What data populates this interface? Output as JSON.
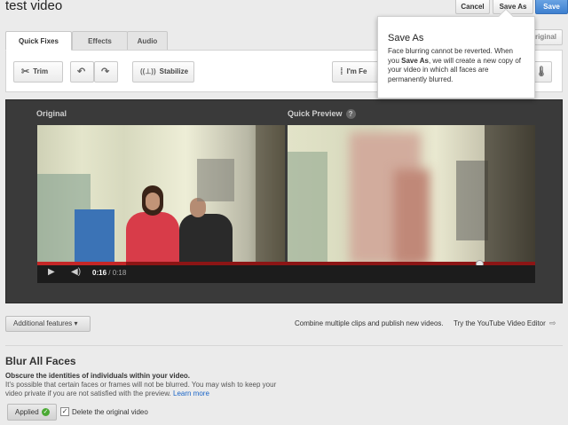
{
  "header": {
    "title": "test video",
    "cancel_label": "Cancel",
    "saveas_label": "Save As",
    "save_label": "Save"
  },
  "tabs": [
    {
      "label": "Quick Fixes"
    },
    {
      "label": "Effects"
    },
    {
      "label": "Audio"
    }
  ],
  "tools": {
    "trim_label": "Trim",
    "stabilize_label": "Stabilize",
    "feeling_lucky_label": "I'm Fe",
    "revert_label": "original"
  },
  "popup": {
    "title": "Save As",
    "text_before": "Face blurring cannot be reverted. When you ",
    "text_bold": "Save As",
    "text_after": ", we will create a new copy of your video in which all faces are permanently blurred."
  },
  "player": {
    "original_label": "Original",
    "preview_label": "Quick Preview",
    "help_glyph": "?",
    "time_current": "0:16",
    "time_total": "/ 0:18",
    "progress": 0.89
  },
  "bottom": {
    "additional_features_label": "Additional features",
    "promo_text": "Combine multiple clips and publish new videos.",
    "promo_link": "Try the YouTube Video Editor"
  },
  "blur": {
    "title": "Blur All Faces",
    "subtitle": "Obscure the identities of individuals within your video.",
    "description": "It's possible that certain faces or frames will not be blurred. You may wish to keep your video private if you are not satisfied with the preview.",
    "learn_more": "Learn more",
    "applied_label": "Applied",
    "delete_label": "Delete the original video",
    "delete_checked": true
  }
}
